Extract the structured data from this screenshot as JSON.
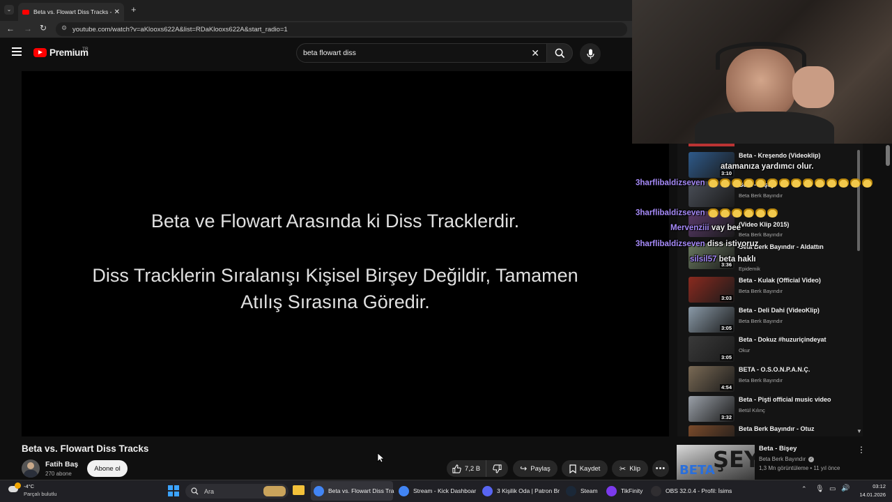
{
  "browser": {
    "tab_title": "Beta vs. Flowart Diss Tracks - Yo",
    "url": "youtube.com/watch?v=aKlooxs622A&list=RDaKlooxs622A&start_radio=1"
  },
  "youtube": {
    "logo_text": "Premium",
    "region": "TR",
    "search_value": "beta flowart diss"
  },
  "video": {
    "line1": "Beta ve Flowart Arasında ki Diss Tracklerdir.",
    "line2": "Diss Tracklerin Sıralanışı Kişisel Birşey Değildir, Tamamen",
    "line3": "Atılış Sırasına Göredir."
  },
  "watch": {
    "title": "Beta vs. Flowart Diss Tracks",
    "channel": "Fatih Baş",
    "subscribers": "270 abone",
    "subscribe_label": "Abone ol",
    "likes": "7,2 B",
    "share_label": "Paylaş",
    "save_label": "Kaydet",
    "clip_label": "Klip"
  },
  "playlist": [
    {
      "title": "Beta - Kreşendo (Videoklip)",
      "channel": "",
      "duration": "3:10",
      "thumb": "#2e5a8a"
    },
    {
      "title": "Beta - Bişey",
      "channel": "Beta Berk Bayındır",
      "duration": "",
      "thumb": "#4a4f58"
    },
    {
      "title": "(Video Klip 2015)",
      "channel": "Beta Berk Bayındır",
      "duration": "",
      "thumb": "#5a3a6a"
    },
    {
      "title": "Beta Berk Bayındır - Aldattın",
      "channel": "Epidemik",
      "duration": "3:36",
      "thumb": "#6a7a60"
    },
    {
      "title": "Beta - Kulak (Official Video)",
      "channel": "Beta Berk Bayındır",
      "duration": "3:03",
      "thumb": "#8a2a1f"
    },
    {
      "title": "Beta - Deli Dahi (VideoKlip)",
      "channel": "Beta Berk Bayındır",
      "duration": "3:05",
      "thumb": "#8a9aa8"
    },
    {
      "title": "Beta - Dokuz #huzuriçindeyat",
      "channel": "Okur",
      "duration": "3:05",
      "thumb": "#3a3a3a"
    },
    {
      "title": "BETA - O.S.O.N.P.A.N.Ç.",
      "channel": "Beta Berk Bayındır",
      "duration": "4:54",
      "thumb": "#7a6a55"
    },
    {
      "title": "Beta - Pişti official music video",
      "channel": "Betül Kılınç",
      "duration": "3:32",
      "thumb": "#9aa0a8"
    },
    {
      "title": "Beta Berk Bayındır - Otuz",
      "channel": "",
      "duration": "",
      "thumb": "#7a4a2a"
    }
  ],
  "chat": [
    {
      "user": "",
      "text": "atamanıza yardımcı olur."
    },
    {
      "user": "3harflibaldizseven",
      "text": ""
    },
    {
      "user": "3harflibaldizseven",
      "text": ""
    },
    {
      "user": "Mervenziii",
      "text": "vay bee"
    },
    {
      "user": "3harflibaldizseven",
      "text": "diss istiyoruz"
    },
    {
      "user": "silsil57",
      "text": "beta haklı"
    }
  ],
  "suggestion": {
    "title": "Beta - Bişey",
    "channel": "Beta Berk Bayındır",
    "meta": "1,3 Mn görüntüleme • 11 yıl önce"
  },
  "taskbar": {
    "weather_temp": "-4°C",
    "weather_desc": "Parçalı bulutlu",
    "search_placeholder": "Ara",
    "apps": [
      {
        "label": "Beta vs. Flowart Diss Tra",
        "color": "#4285f4"
      },
      {
        "label": "Stream - Kick Dashboar",
        "color": "#4285f4"
      },
      {
        "label": "3 Kişilik Oda | Patron Br",
        "color": "#5865f2"
      },
      {
        "label": "Steam",
        "color": "#1b2838"
      },
      {
        "label": "TikFinity",
        "color": "#7c3aed"
      },
      {
        "label": "OBS 32.0.4 - Profil: İsims",
        "color": "#302e31"
      }
    ],
    "time": "03:12",
    "date": "14.01.2026"
  },
  "colors": {
    "accent": "#ff0000",
    "chat_user": "#a78bfa"
  }
}
